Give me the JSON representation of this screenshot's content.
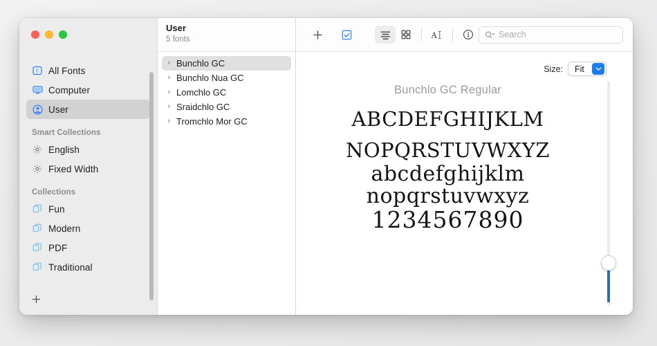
{
  "window": {
    "traffic_lights": [
      {
        "name": "close",
        "color": "#ff5f57"
      },
      {
        "name": "minimize",
        "color": "#febc2e"
      },
      {
        "name": "maximize",
        "color": "#28c840"
      }
    ]
  },
  "sidebar": {
    "items": [
      {
        "label": "All Fonts",
        "icon": "all-fonts-icon",
        "selected": false
      },
      {
        "label": "Computer",
        "icon": "computer-icon",
        "selected": false
      },
      {
        "label": "User",
        "icon": "user-icon",
        "selected": true
      }
    ],
    "smart_collections_header": "Smart Collections",
    "smart_collections": [
      {
        "label": "English",
        "icon": "gear-icon"
      },
      {
        "label": "Fixed Width",
        "icon": "gear-icon"
      }
    ],
    "collections_header": "Collections",
    "collections": [
      {
        "label": "Fun",
        "icon": "collection-icon"
      },
      {
        "label": "Modern",
        "icon": "collection-icon"
      },
      {
        "label": "PDF",
        "icon": "collection-icon"
      },
      {
        "label": "Traditional",
        "icon": "collection-icon"
      }
    ],
    "add_collection_label": "+"
  },
  "list_panel": {
    "title": "User",
    "subtitle": "5 fonts",
    "fonts": [
      {
        "name": "Bunchlo GC",
        "selected": true
      },
      {
        "name": "Bunchlo Nua GC",
        "selected": false
      },
      {
        "name": "Lomchlo GC",
        "selected": false
      },
      {
        "name": "Sraidchlo GC",
        "selected": false
      },
      {
        "name": "Tromchlo Mor GC",
        "selected": false
      }
    ],
    "disclosure_glyph": "›"
  },
  "toolbar": {
    "add_font_label": "+",
    "buttons": [
      {
        "name": "add-font-button",
        "icon": "plus-icon"
      },
      {
        "name": "validate-font-button",
        "icon": "checkbox-icon"
      },
      {
        "name": "sample-view-button",
        "icon": "list-lines-icon",
        "active": true
      },
      {
        "name": "repertoire-view-button",
        "icon": "grid-icon",
        "active": false
      },
      {
        "name": "custom-view-button",
        "icon": "text-cursor-icon",
        "active": false
      },
      {
        "name": "info-button",
        "icon": "info-circle-icon",
        "active": false
      }
    ],
    "search": {
      "placeholder": "Search",
      "value": "",
      "icon": "search-icon"
    }
  },
  "preview": {
    "size_label": "Size:",
    "size_value": "Fit",
    "size_chevron": "˅",
    "font_title": "Bunchlo GC Regular",
    "lines": [
      "abcdefghijklm",
      "nopqrstuvwxyz",
      "abcdefghijklm",
      "nopqrstuvwxyz",
      "1234567890"
    ],
    "slider": {
      "name": "font-size-slider",
      "fill_color": "#2a6ebb",
      "track_color": "#eaeaea"
    }
  }
}
